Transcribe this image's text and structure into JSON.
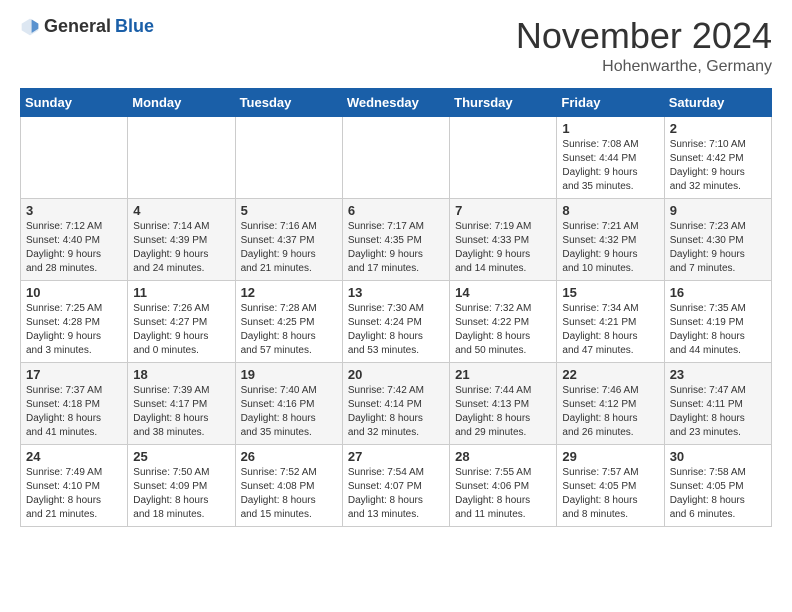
{
  "logo": {
    "general": "General",
    "blue": "Blue"
  },
  "header": {
    "month": "November 2024",
    "location": "Hohenwarthe, Germany"
  },
  "weekdays": [
    "Sunday",
    "Monday",
    "Tuesday",
    "Wednesday",
    "Thursday",
    "Friday",
    "Saturday"
  ],
  "weeks": [
    [
      {
        "day": "",
        "info": ""
      },
      {
        "day": "",
        "info": ""
      },
      {
        "day": "",
        "info": ""
      },
      {
        "day": "",
        "info": ""
      },
      {
        "day": "",
        "info": ""
      },
      {
        "day": "1",
        "info": "Sunrise: 7:08 AM\nSunset: 4:44 PM\nDaylight: 9 hours\nand 35 minutes."
      },
      {
        "day": "2",
        "info": "Sunrise: 7:10 AM\nSunset: 4:42 PM\nDaylight: 9 hours\nand 32 minutes."
      }
    ],
    [
      {
        "day": "3",
        "info": "Sunrise: 7:12 AM\nSunset: 4:40 PM\nDaylight: 9 hours\nand 28 minutes."
      },
      {
        "day": "4",
        "info": "Sunrise: 7:14 AM\nSunset: 4:39 PM\nDaylight: 9 hours\nand 24 minutes."
      },
      {
        "day": "5",
        "info": "Sunrise: 7:16 AM\nSunset: 4:37 PM\nDaylight: 9 hours\nand 21 minutes."
      },
      {
        "day": "6",
        "info": "Sunrise: 7:17 AM\nSunset: 4:35 PM\nDaylight: 9 hours\nand 17 minutes."
      },
      {
        "day": "7",
        "info": "Sunrise: 7:19 AM\nSunset: 4:33 PM\nDaylight: 9 hours\nand 14 minutes."
      },
      {
        "day": "8",
        "info": "Sunrise: 7:21 AM\nSunset: 4:32 PM\nDaylight: 9 hours\nand 10 minutes."
      },
      {
        "day": "9",
        "info": "Sunrise: 7:23 AM\nSunset: 4:30 PM\nDaylight: 9 hours\nand 7 minutes."
      }
    ],
    [
      {
        "day": "10",
        "info": "Sunrise: 7:25 AM\nSunset: 4:28 PM\nDaylight: 9 hours\nand 3 minutes."
      },
      {
        "day": "11",
        "info": "Sunrise: 7:26 AM\nSunset: 4:27 PM\nDaylight: 9 hours\nand 0 minutes."
      },
      {
        "day": "12",
        "info": "Sunrise: 7:28 AM\nSunset: 4:25 PM\nDaylight: 8 hours\nand 57 minutes."
      },
      {
        "day": "13",
        "info": "Sunrise: 7:30 AM\nSunset: 4:24 PM\nDaylight: 8 hours\nand 53 minutes."
      },
      {
        "day": "14",
        "info": "Sunrise: 7:32 AM\nSunset: 4:22 PM\nDaylight: 8 hours\nand 50 minutes."
      },
      {
        "day": "15",
        "info": "Sunrise: 7:34 AM\nSunset: 4:21 PM\nDaylight: 8 hours\nand 47 minutes."
      },
      {
        "day": "16",
        "info": "Sunrise: 7:35 AM\nSunset: 4:19 PM\nDaylight: 8 hours\nand 44 minutes."
      }
    ],
    [
      {
        "day": "17",
        "info": "Sunrise: 7:37 AM\nSunset: 4:18 PM\nDaylight: 8 hours\nand 41 minutes."
      },
      {
        "day": "18",
        "info": "Sunrise: 7:39 AM\nSunset: 4:17 PM\nDaylight: 8 hours\nand 38 minutes."
      },
      {
        "day": "19",
        "info": "Sunrise: 7:40 AM\nSunset: 4:16 PM\nDaylight: 8 hours\nand 35 minutes."
      },
      {
        "day": "20",
        "info": "Sunrise: 7:42 AM\nSunset: 4:14 PM\nDaylight: 8 hours\nand 32 minutes."
      },
      {
        "day": "21",
        "info": "Sunrise: 7:44 AM\nSunset: 4:13 PM\nDaylight: 8 hours\nand 29 minutes."
      },
      {
        "day": "22",
        "info": "Sunrise: 7:46 AM\nSunset: 4:12 PM\nDaylight: 8 hours\nand 26 minutes."
      },
      {
        "day": "23",
        "info": "Sunrise: 7:47 AM\nSunset: 4:11 PM\nDaylight: 8 hours\nand 23 minutes."
      }
    ],
    [
      {
        "day": "24",
        "info": "Sunrise: 7:49 AM\nSunset: 4:10 PM\nDaylight: 8 hours\nand 21 minutes."
      },
      {
        "day": "25",
        "info": "Sunrise: 7:50 AM\nSunset: 4:09 PM\nDaylight: 8 hours\nand 18 minutes."
      },
      {
        "day": "26",
        "info": "Sunrise: 7:52 AM\nSunset: 4:08 PM\nDaylight: 8 hours\nand 15 minutes."
      },
      {
        "day": "27",
        "info": "Sunrise: 7:54 AM\nSunset: 4:07 PM\nDaylight: 8 hours\nand 13 minutes."
      },
      {
        "day": "28",
        "info": "Sunrise: 7:55 AM\nSunset: 4:06 PM\nDaylight: 8 hours\nand 11 minutes."
      },
      {
        "day": "29",
        "info": "Sunrise: 7:57 AM\nSunset: 4:05 PM\nDaylight: 8 hours\nand 8 minutes."
      },
      {
        "day": "30",
        "info": "Sunrise: 7:58 AM\nSunset: 4:05 PM\nDaylight: 8 hours\nand 6 minutes."
      }
    ]
  ]
}
